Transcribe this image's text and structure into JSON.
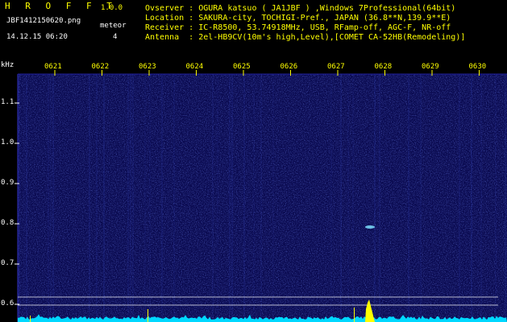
{
  "header": {
    "app_name": "H R O F F T",
    "version": "1.0.0",
    "filename": "JBF1412150620.png",
    "meteor_label": "meteor",
    "meteor_count": "4",
    "datetime": "14.12.15 06:20",
    "info_lines": [
      "Ovserver : OGURA katsuo ( JA1JBF ) ,Windows 7Professional(64bit)",
      "Location : SAKURA-city, TOCHIGI-Pref., JAPAN (36.8**N,139.9**E)",
      "Receiver : IC-R8500, 53.74918MHz, USB, RFamp-off, AGC-F, NR-off",
      "Antenna  : 2el-HB9CV(10m's high,Level),[COMET CA-52HB(Remodeling)]"
    ]
  },
  "spectrogram": {
    "y_unit": "kHz",
    "y_ticks": [
      "1.1",
      "1.0",
      "0.9",
      "0.8",
      "0.7",
      "0.6"
    ],
    "x_ticks": [
      "0621",
      "0622",
      "0623",
      "0624",
      "0625",
      "0626",
      "0627",
      "0628",
      "0629",
      "0630"
    ],
    "colors": {
      "background": "#0a0a50",
      "noise": "#2a3cc8",
      "trace": "#00ffff",
      "spike": "#ffff00",
      "grid": "#ffffff",
      "tick": "#ffff00"
    }
  }
}
